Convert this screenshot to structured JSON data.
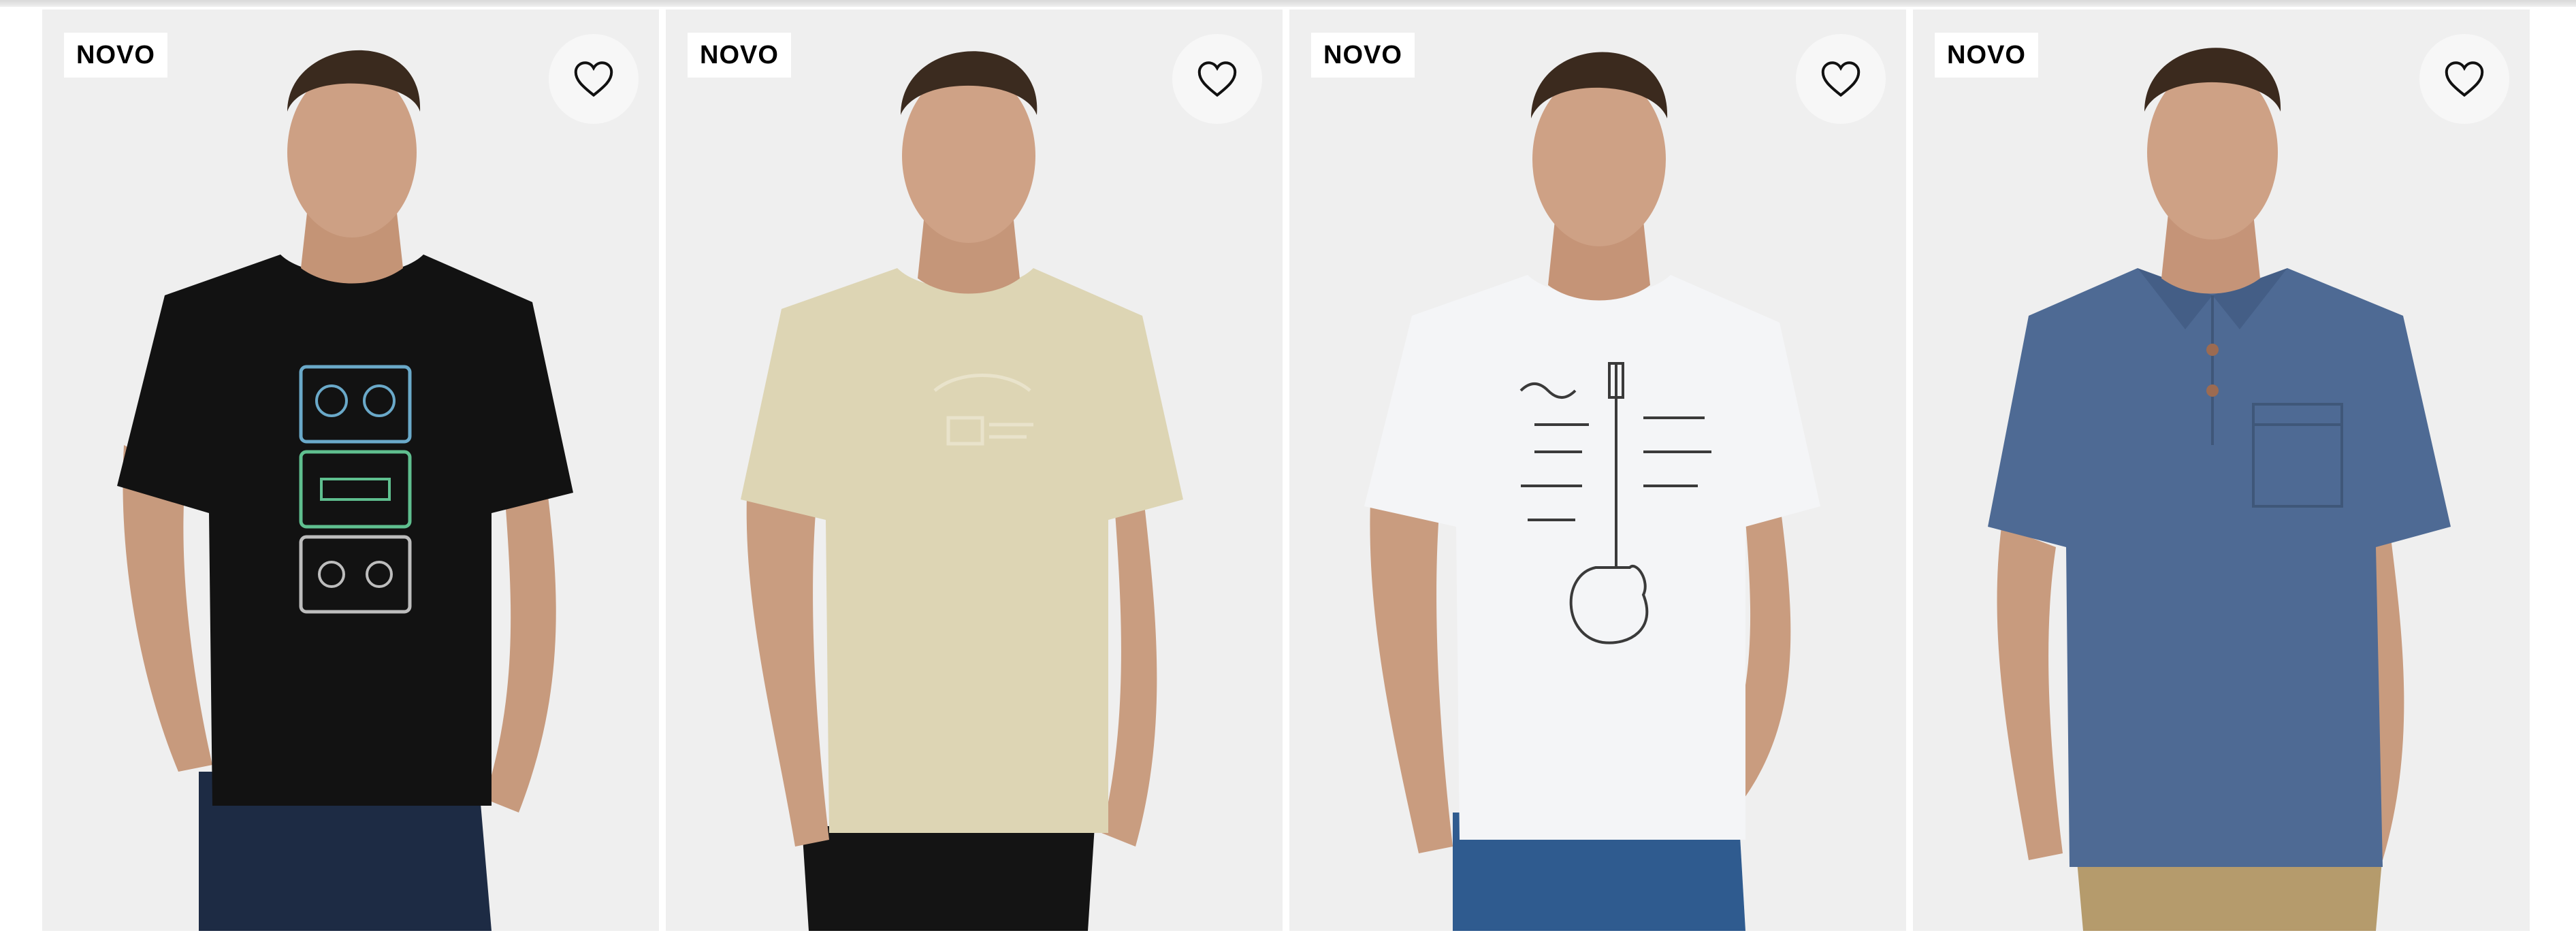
{
  "products": [
    {
      "badge": "NOVO",
      "shirt": "black tee with cassette print",
      "shirt_color": "#121212",
      "print": "cassettes",
      "pants_color": "#1d2b44"
    },
    {
      "badge": "NOVO",
      "shirt": "beige tee with tonal logo",
      "shirt_color": "#ddd5b4",
      "print": "tonal-logo",
      "pants_color": "#141414"
    },
    {
      "badge": "NOVO",
      "shirt": "white tee with guitar lettering print",
      "shirt_color": "#f4f5f7",
      "print": "guitar-lettering",
      "pants_color": "#2f5b8f"
    },
    {
      "badge": "NOVO",
      "shirt": "blue heather polo shirt",
      "shirt_color": "#4e6a94",
      "print": "polo-pocket",
      "pants_color": "#b59b6c"
    }
  ],
  "icons": {
    "favorite": "heart-outline-icon"
  },
  "colors": {
    "card_background": "#efefef",
    "badge_background": "#ffffff",
    "badge_text": "#000000"
  }
}
